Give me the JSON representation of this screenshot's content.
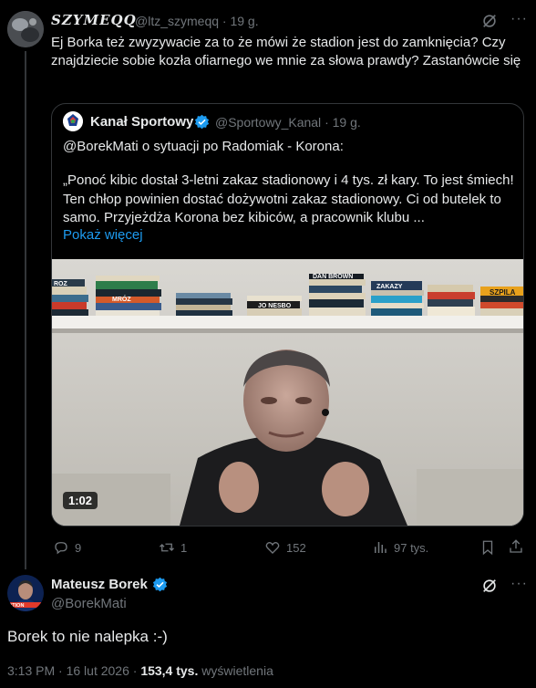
{
  "reply": {
    "author_name": "SZYMEQQ",
    "author_handle": "@ltz_szymeqq",
    "time": "· 19 g.",
    "text": "Ej Borka też zwyzywacie za to że mówi że stadion jest do zamknięcia? Czy znajdziecie sobie kozła ofiarnego we mnie za słowa prawdy? Zastanówcie się"
  },
  "quote": {
    "author_name": "Kanał Sportowy",
    "author_handle": "@Sportowy_Kanal",
    "time": "· 19 g.",
    "line1": "@BorekMati o sytuacji po Radomiak - Korona:",
    "body": "„Ponoć kibic dostał 3-letni zakaz stadionowy i 4 tys. zł kary. To jest śmiech! Ten chłop powinien dostać dożywotni zakaz stadionowy. Ci od butelek to samo. Przyjeżdża Korona bez kibiców, a pracownik klubu ...",
    "show_more": "Pokaż więcej",
    "video_duration": "1:02",
    "book_labels": [
      "ROZ",
      "MRÓZ",
      "JO NESBO",
      "DAN BROWN",
      "ZAKAZY",
      "SZPILA"
    ]
  },
  "actions": {
    "replies": "9",
    "reposts": "1",
    "likes": "152",
    "views": "97 tys."
  },
  "main": {
    "author_name": "Mateusz Borek",
    "author_handle": "@BorekMati",
    "text": "Borek to nie nalepka :-)",
    "timestamp": "3:13 PM · 16 lut 2026 · ",
    "views_count": "153,4 tys.",
    "views_label": " wyświetlenia",
    "avatar_text": "OTION"
  },
  "colors": {
    "background": "#000000",
    "text": "#e7e9ea",
    "muted": "#71767b",
    "link": "#1d9bf0",
    "border": "#333639",
    "verified": "#1d9bf0"
  }
}
